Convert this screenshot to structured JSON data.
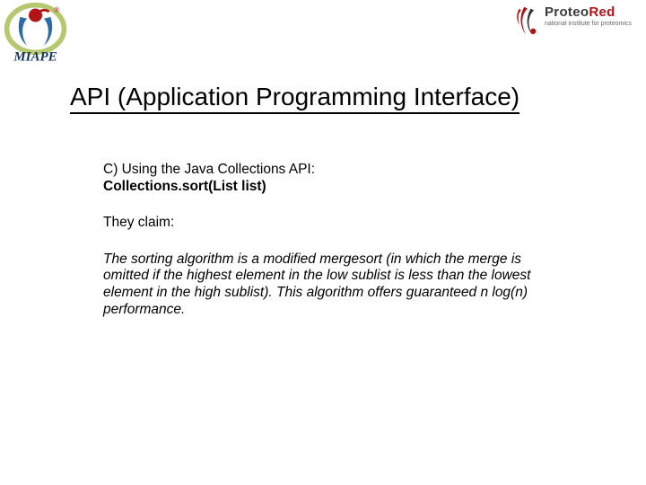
{
  "logos": {
    "left_alt": "MIAPE",
    "right_brand_part1": "Proteo",
    "right_brand_part2": "Red",
    "right_subtitle": "national institute for proteomics"
  },
  "title": "API (Application Programming Interface)",
  "section": {
    "lead_line": "C)  Using the Java Collections API:",
    "code_line": "Collections.sort(List list)",
    "claim_intro": "They claim:",
    "claim_body": "The sorting algorithm is a modified mergesort (in which the merge is omitted if the highest element in the low sublist is less than the lowest element in the high sublist). This algorithm offers guaranteed n log(n) performance."
  }
}
